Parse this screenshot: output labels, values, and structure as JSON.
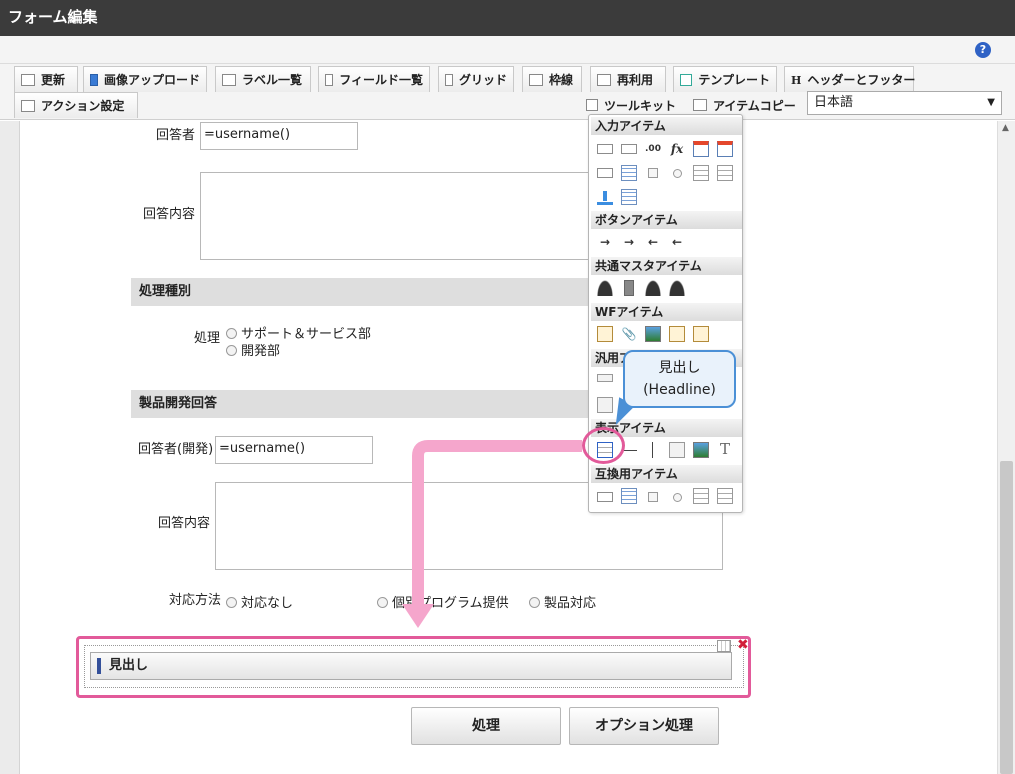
{
  "window": {
    "title": "フォーム編集"
  },
  "help": {
    "glyph": "?"
  },
  "toolbar": {
    "tabs": [
      "更新",
      "画像アップロード",
      "ラベル一覧",
      "フィールド一覧",
      "グリッド",
      "枠線",
      "再利用",
      "テンプレート",
      "ヘッダーとフッター"
    ],
    "tabs2": [
      "アクション設定",
      "ツールキット",
      "アイテムコピー"
    ],
    "header_glyph": "H",
    "language": "日本語"
  },
  "form": {
    "respondent_label": "回答者",
    "respondent_value": "=username()",
    "answer_label": "回答内容",
    "section1": "処理種別",
    "process_label": "処理",
    "process_options": [
      "サポート＆サービス部",
      "開発部"
    ],
    "section2": "製品開発回答",
    "respondent_dev_label": "回答者(開発)",
    "respondent_dev_value": "=username()",
    "answer2_label": "回答内容",
    "response_label": "対応方法",
    "response_options": [
      "対応なし",
      "個別プログラム提供",
      "製品対応"
    ],
    "headline_text": "見出し",
    "process_button": "処理",
    "option_button": "オプション処理"
  },
  "palette": {
    "sections": [
      "入力アイテム",
      "ボタンアイテム",
      "共通マスタアイテム",
      "WFアイテム",
      "汎用アイテム",
      "表示アイテム",
      "互換用アイテム"
    ],
    "glyph_fx": "fx",
    "glyph_decimal": ".00",
    "glyph_text": "T"
  },
  "callout": {
    "line1": "見出し",
    "line2": "(Headline)"
  },
  "colors": {
    "highlight": "#e25a9a",
    "callout_border": "#4b90d6",
    "titlebar": "#3b3b3b"
  }
}
